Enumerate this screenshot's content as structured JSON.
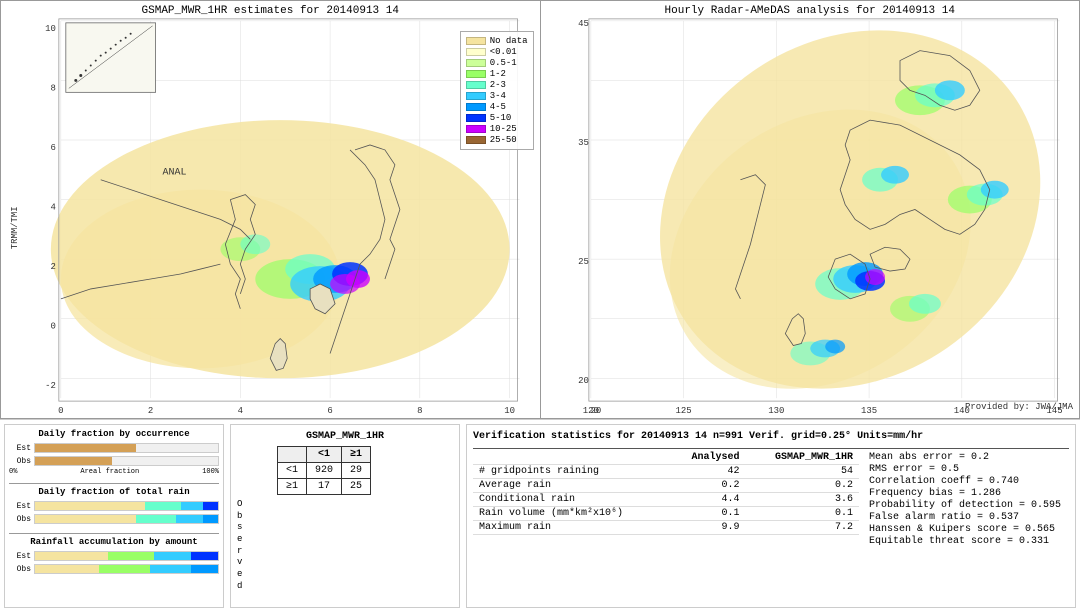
{
  "maps": {
    "left": {
      "title": "GSMAP_MWR_1HR estimates for 20140913 14",
      "y_label": "TRMM/TMI",
      "anal_label": "ANAL"
    },
    "right": {
      "title": "Hourly Radar-AMeDAS analysis for 20140913 14",
      "provided_by": "Provided by: JWA/JMA"
    }
  },
  "legend": {
    "title": "No data",
    "items": [
      {
        "label": "No data",
        "color": "#F5E4A0"
      },
      {
        "label": "<0.01",
        "color": "#FFFFCC"
      },
      {
        "label": "0.5-1",
        "color": "#CCFF99"
      },
      {
        "label": "1-2",
        "color": "#99FF66"
      },
      {
        "label": "2-3",
        "color": "#66FFCC"
      },
      {
        "label": "3-4",
        "color": "#33CCFF"
      },
      {
        "label": "4-5",
        "color": "#0099FF"
      },
      {
        "label": "5-10",
        "color": "#0033FF"
      },
      {
        "label": "10-25",
        "color": "#CC00FF"
      },
      {
        "label": "25-50",
        "color": "#996633"
      }
    ]
  },
  "charts": {
    "daily_occurrence_title": "Daily fraction by occurrence",
    "daily_rain_title": "Daily fraction of total rain",
    "rainfall_acc_title": "Rainfall accumulation by amount",
    "est_label": "Est",
    "obs_label": "Obs",
    "axis_0": "0%",
    "axis_100": "100%",
    "axis_label": "Areal fraction"
  },
  "contingency": {
    "title": "GSMAP_MWR_1HR",
    "col_lt1": "<1",
    "col_ge1": "≥1",
    "row_lt1": "<1",
    "row_ge1": "≥1",
    "obs_label": "O\nb\ns\ne\nr\nv\ne\nd",
    "v11": "920",
    "v12": "29",
    "v21": "17",
    "v22": "25"
  },
  "verification": {
    "title": "Verification statistics for 20140913 14  n=991  Verif. grid=0.25°  Units=mm/hr",
    "table": {
      "headers": [
        "",
        "Analysed",
        "GSMAP_MWR_1HR"
      ],
      "rows": [
        {
          "label": "# gridpoints raining",
          "analysed": "42",
          "gsmap": "54"
        },
        {
          "label": "Average rain",
          "analysed": "0.2",
          "gsmap": "0.2"
        },
        {
          "label": "Conditional rain",
          "analysed": "4.4",
          "gsmap": "3.6"
        },
        {
          "label": "Rain volume (mm*km²x10⁶)",
          "analysed": "0.1",
          "gsmap": "0.1"
        },
        {
          "label": "Maximum rain",
          "analysed": "9.9",
          "gsmap": "7.2"
        }
      ]
    },
    "metrics": [
      {
        "label": "Mean abs error = 0.2"
      },
      {
        "label": "RMS error = 0.5"
      },
      {
        "label": "Correlation coeff = 0.740"
      },
      {
        "label": "Frequency bias = 1.286"
      },
      {
        "label": "Probability of detection = 0.595"
      },
      {
        "label": "False alarm ratio = 0.537"
      },
      {
        "label": "Hanssen & Kuipers score = 0.565"
      },
      {
        "label": "Equitable threat score = 0.331"
      }
    ]
  }
}
